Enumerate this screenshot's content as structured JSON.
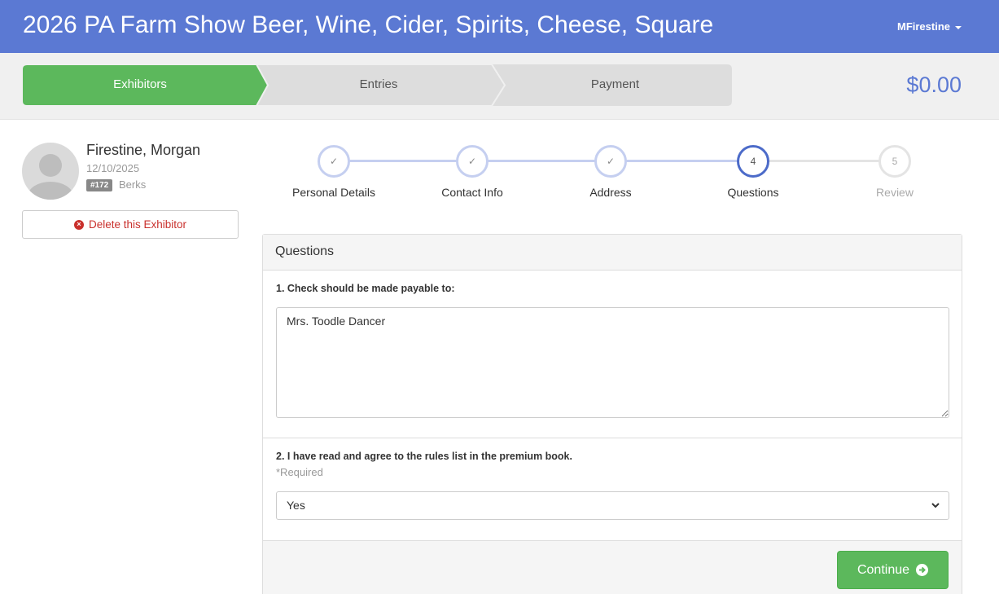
{
  "header": {
    "title": "2026 PA Farm Show Beer, Wine, Cider, Spirits, Cheese, Square",
    "user": "MFirestine",
    "brand_color": "#5b79d3"
  },
  "wizard": {
    "steps": [
      {
        "label": "Exhibitors",
        "state": "active"
      },
      {
        "label": "Entries",
        "state": "inactive"
      },
      {
        "label": "Payment",
        "state": "inactive"
      }
    ],
    "total": "$0.00",
    "active_color": "#5cb85c"
  },
  "exhibitor": {
    "name": "Firestine, Morgan",
    "date": "12/10/2025",
    "number": "#172",
    "county": "Berks",
    "delete_label": "Delete this Exhibitor"
  },
  "progress": {
    "steps": [
      {
        "label": "Personal Details",
        "state": "done",
        "icon": "check-icon"
      },
      {
        "label": "Contact Info",
        "state": "done",
        "icon": "check-icon"
      },
      {
        "label": "Address",
        "state": "done",
        "icon": "check-icon"
      },
      {
        "label": "Questions",
        "state": "current",
        "number": "4"
      },
      {
        "label": "Review",
        "state": "todo",
        "number": "5"
      }
    ]
  },
  "questions": {
    "heading": "Questions",
    "q1": {
      "label": "1. Check should be made payable to:",
      "value": "Mrs. Toodle Dancer"
    },
    "q2": {
      "label": "2. I have read and agree to the rules list in the premium book.",
      "help": "*Required",
      "selected": "Yes"
    },
    "continue_label": "Continue"
  }
}
